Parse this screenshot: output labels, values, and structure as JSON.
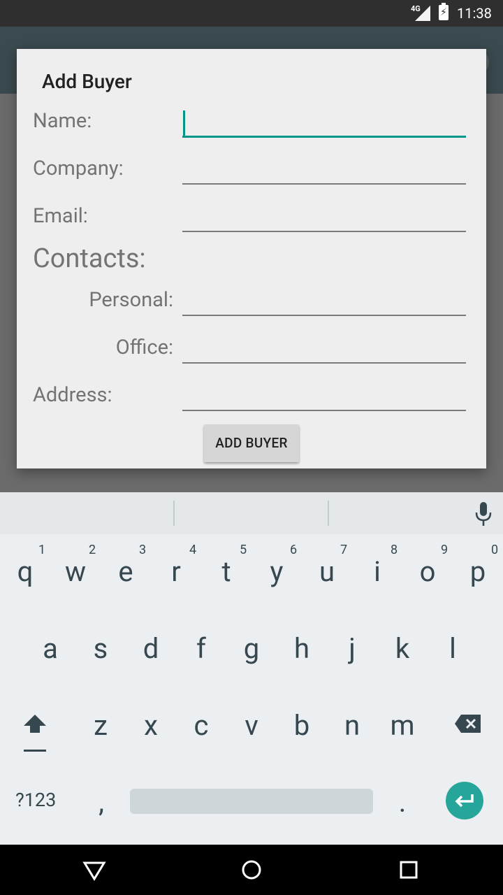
{
  "status_bar": {
    "network": "4G",
    "time": "11:38"
  },
  "dialog": {
    "title": "Add Buyer",
    "labels": {
      "name": "Name:",
      "company": "Company:",
      "email": "Email:",
      "contacts": "Contacts:",
      "personal": "Personal:",
      "office": "Office:",
      "address": "Address:"
    },
    "fields": {
      "name": "",
      "company": "",
      "email": "",
      "personal": "",
      "office": "",
      "address": ""
    },
    "add_button_label": "ADD BUYER"
  },
  "keyboard": {
    "row1": [
      "q",
      "w",
      "e",
      "r",
      "t",
      "y",
      "u",
      "i",
      "o",
      "p"
    ],
    "row1_hints": [
      "1",
      "2",
      "3",
      "4",
      "5",
      "6",
      "7",
      "8",
      "9",
      "0"
    ],
    "row2": [
      "a",
      "s",
      "d",
      "f",
      "g",
      "h",
      "j",
      "k",
      "l"
    ],
    "row3": [
      "z",
      "x",
      "c",
      "v",
      "b",
      "n",
      "m"
    ],
    "symbols_label": "?123",
    "comma": ",",
    "period": ".",
    "accent_color": "#26a69a"
  },
  "navigation": {
    "back": "back-icon",
    "home": "home-icon",
    "recents": "recents-icon"
  }
}
